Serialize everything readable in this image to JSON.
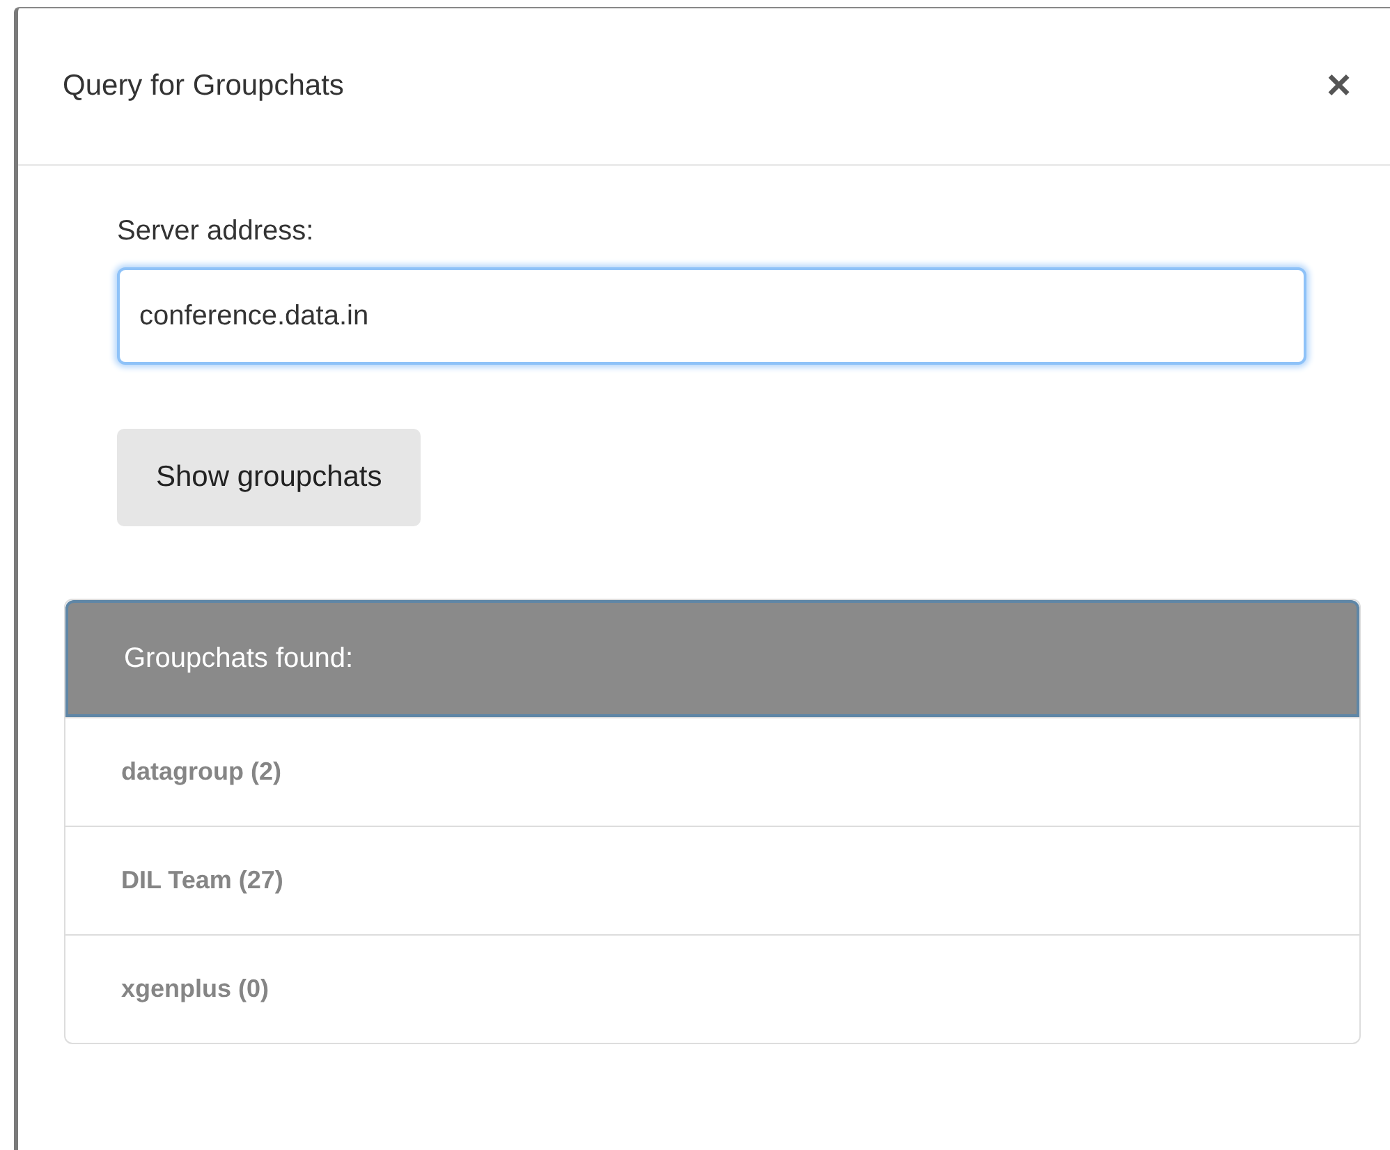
{
  "dialog": {
    "title": "Query for Groupchats",
    "close": "×"
  },
  "server_field": {
    "label": "Server address:",
    "value": "conference.data.in",
    "focused": true
  },
  "show_button": {
    "label": "Show groupchats"
  },
  "results": {
    "heading": "Groupchats found:",
    "items": [
      {
        "label": "datagroup (2)"
      },
      {
        "label": "DIL Team (27)"
      },
      {
        "label": "xgenplus (0)"
      }
    ]
  }
}
